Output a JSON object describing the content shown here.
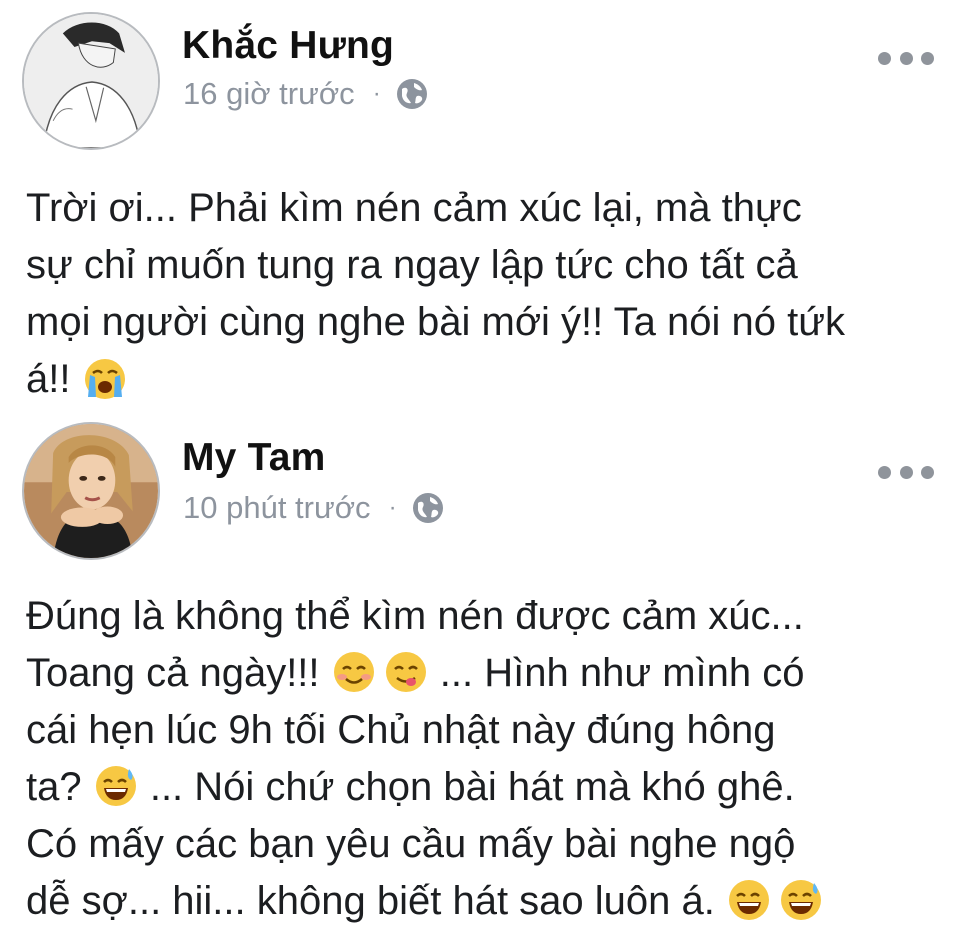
{
  "posts": [
    {
      "author": "Khắc Hưng",
      "time": "16 giờ trước",
      "separator": "·",
      "privacy_icon": "globe-icon",
      "more_icon": "more-options-icon",
      "lines": [
        {
          "text": "Trời ơi... Phải kìm nén cảm xúc lại, mà thực"
        },
        {
          "text": "sự chỉ muốn tung ra ngay lập tức cho tất cả"
        },
        {
          "text": "mọi người cùng nghe bài mới ý!! Ta nói nó tứk"
        },
        {
          "text": "á!! ",
          "emoji_after": "crying-face-emoji"
        }
      ]
    },
    {
      "author": "My Tam",
      "time": "10 phút trước",
      "separator": "·",
      "privacy_icon": "globe-icon",
      "more_icon": "more-options-icon",
      "lines": [
        {
          "text": "Đúng là không thể kìm nén được cảm xúc..."
        },
        {
          "text_a": "Toang cả ngày!!! ",
          "text_b": " ... Hình như mình có",
          "emojis": [
            "smiling-face-emoji",
            "yum-face-emoji"
          ]
        },
        {
          "text": "cái hẹn lúc 9h tối Chủ nhật này đúng hông"
        },
        {
          "text_a": "ta? ",
          "text_b": " ... Nói chứ chọn bài hát mà khó ghê.",
          "emojis": [
            "grinning-sweat-emoji"
          ]
        },
        {
          "text": "Có mấy các bạn yêu cầu mấy bài nghe ngộ"
        },
        {
          "text": "dễ sợ... hii... không biết hát sao luôn á. ",
          "emojis_after": [
            "grinning-emoji",
            "grinning-sweat-emoji"
          ]
        }
      ]
    }
  ]
}
